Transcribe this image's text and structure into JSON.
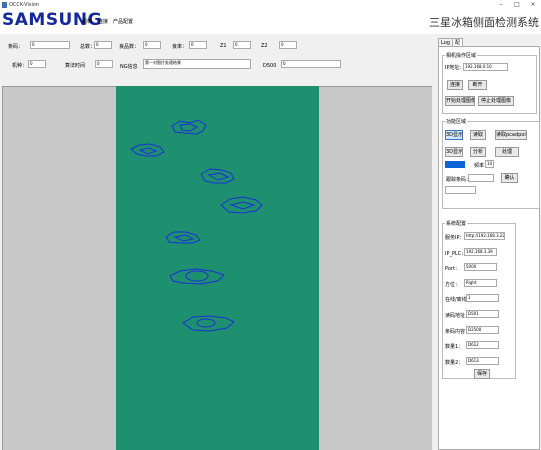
{
  "window": {
    "title": "OCCK-Vision",
    "controls": [
      "–",
      "□",
      "×"
    ]
  },
  "header": {
    "brand": "SAMSUNG",
    "menu": [
      "图档",
      "连接",
      "产品配置"
    ],
    "title": "三星冰箱侧面检测系统"
  },
  "fields": {
    "barcode_label": "条码：",
    "barcode_value": "0",
    "total_label": "总数：",
    "total_value": "0",
    "good_label": "良品数：",
    "good_value": "0",
    "rate_label": "良率：",
    "rate_value": "0",
    "z1_label": "Z1",
    "z1_value": "0",
    "z2_label": "Z2",
    "z2_value": "0",
    "model_label": "机种：",
    "model_value": "0",
    "time_label": "算法时间",
    "time_value": "0",
    "ng_label": "NG信息",
    "ng_value": "第一对图片处理结果",
    "d500_label": "D500",
    "d500_value": "0"
  },
  "panel": {
    "tabs": [
      "Log",
      "配置"
    ],
    "camera_group": {
      "title": "相机操作区域",
      "ip_label": "IP地址：",
      "ip_value": "192.168.0.10",
      "connect": "连接",
      "disconnect": "断开",
      "start_capture": "开始处理图像",
      "stop_capture": "停止处理图像"
    },
    "func_group": {
      "title": "功能区域",
      "btn_3d_show": "3D显示",
      "btn_read": "读取",
      "btn_read_pcd": "读取pcadpoint",
      "btn_3d_show2": "3D显示",
      "btn_analyze": "分析",
      "btn_process": "处理",
      "freq_label": "频率：",
      "freq_value": "10",
      "mode_value": "",
      "current_label": "跟踪条码：",
      "current_value": "",
      "confirm": "确认"
    },
    "system_group": {
      "title": "系统配置",
      "rows": [
        {
          "label": "服务IP：",
          "value": "http://192.168.3.22"
        },
        {
          "label": "IP_PLC：",
          "value": "192.168.3.39"
        },
        {
          "label": "Port：",
          "value": "5000"
        },
        {
          "label": "方位：",
          "value": "Right"
        },
        {
          "label": "在线/离线：",
          "value": "1"
        },
        {
          "label": "读码地址：",
          "value": "D501"
        },
        {
          "label": "条码内容：",
          "value": "D2500"
        },
        {
          "label": "数量1：",
          "value": "D612"
        },
        {
          "label": "数量2：",
          "value": "D613"
        }
      ],
      "save": "保存"
    }
  },
  "colors": {
    "brand": "#1428a0",
    "canvas": "#1e8f6f",
    "viewer_bg": "#c8c8c8",
    "defect_outline": "#1c2fd8"
  }
}
